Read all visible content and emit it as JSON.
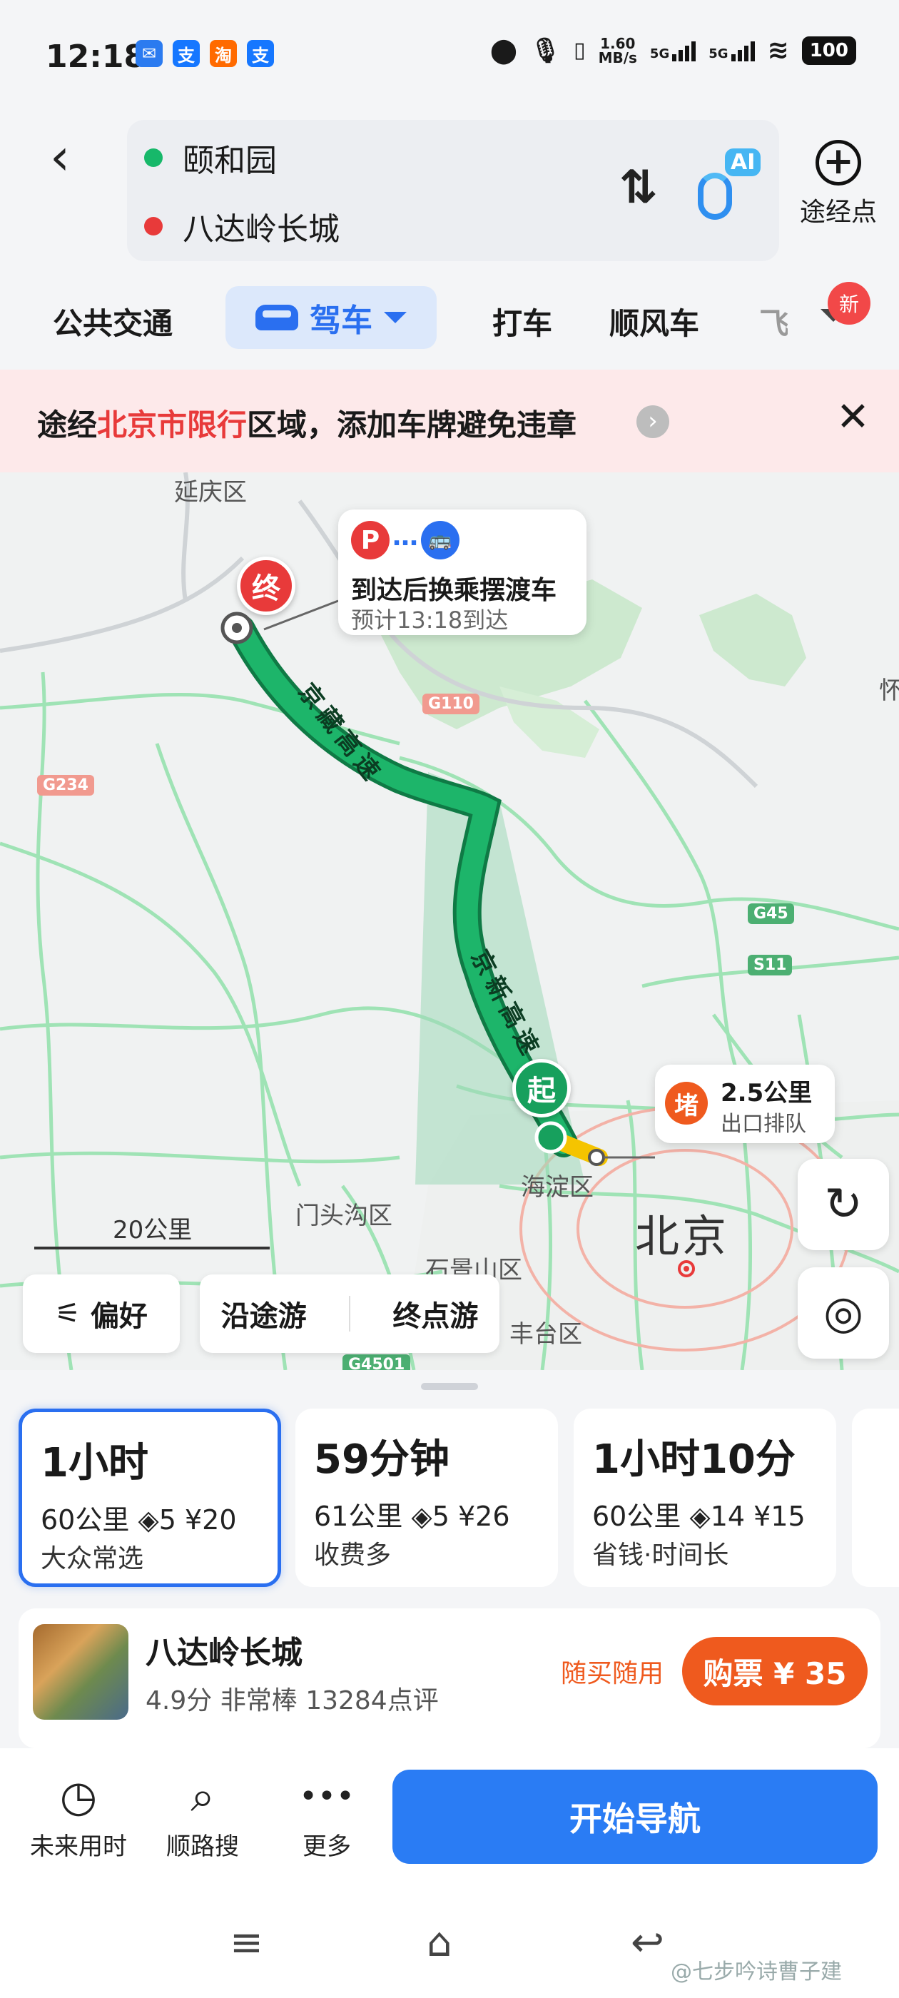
{
  "status_bar": {
    "time": "12:18",
    "apps": [
      {
        "icon": "chat-icon",
        "text": "✉",
        "color": "#2b7bf0"
      },
      {
        "icon": "alipay-icon",
        "text": "支",
        "color": "#1677ff"
      },
      {
        "icon": "taobao-icon",
        "text": "淘",
        "color": "#ff6a00"
      },
      {
        "icon": "alipay-icon",
        "text": "支",
        "color": "#1677ff"
      }
    ],
    "net_speed": "1.60",
    "net_unit": "MB/s",
    "signal1": "5G",
    "signal2": "5G",
    "battery": "100"
  },
  "header": {
    "origin": "颐和园",
    "destination": "八达岭长城",
    "swap_symbol": "⇅",
    "ai_label": "AI",
    "waypoint_label": "途经点"
  },
  "tabs": {
    "transit": "公共交通",
    "drive": "驾车",
    "taxi": "打车",
    "carpool": "顺风车",
    "flight": "飞",
    "new_badge": "新"
  },
  "banner": {
    "prefix": "途经",
    "highlight": "北京市限行",
    "suffix": "区域，添加车牌避免违章",
    "arrow": "›",
    "close": "✕"
  },
  "map": {
    "labels": {
      "yanqing": "延庆区",
      "haidian": "海淀区",
      "mentougou": "门头沟区",
      "shijingshan": "石景山区",
      "fengtai": "丰台区",
      "beijing": "北京",
      "huai": "怀"
    },
    "road_badges": {
      "g110": "G110",
      "g234": "G234",
      "g45": "G45",
      "s11": "S11",
      "g4501": "G4501"
    },
    "route_labels": {
      "jingzang": "京藏高速",
      "jingxin": "京新高速"
    },
    "callout": {
      "parking": "P",
      "dots": "…",
      "bus": "🚌",
      "title": "到达后换乘摆渡车",
      "eta": "预计13:18到达"
    },
    "end_pin": "终",
    "start_pin": "起",
    "jam": {
      "icon": "堵",
      "distance": "2.5公里",
      "desc": "出口排队"
    },
    "scale_text": "20公里",
    "refresh_icon": "↻",
    "locate_icon": "◎",
    "chips": {
      "pref": "偏好",
      "pref_icon": "⚟",
      "along": "沿途游",
      "endpoint": "终点游"
    }
  },
  "routes": [
    {
      "time": "1小时",
      "distance": "60公里",
      "lights": "5",
      "toll": "¥20",
      "tag": "大众常选",
      "selected": true
    },
    {
      "time": "59分钟",
      "distance": "61公里",
      "lights": "5",
      "toll": "¥26",
      "tag": "收费多",
      "selected": false
    },
    {
      "time": "1小时10分",
      "distance": "60公里",
      "lights": "14",
      "toll": "¥15",
      "tag": "省钱·时间长",
      "selected": false
    }
  ],
  "traffic_light_icon": "◈",
  "poi": {
    "name": "八达岭长城",
    "rating": "4.9分",
    "level": "非常棒",
    "reviews": "13284点评",
    "promo": "随买随用",
    "buy": "购票 ¥ 35"
  },
  "actions": {
    "later": "未来用时",
    "later_icon": "◷",
    "search": "顺路搜",
    "search_icon": "⌕",
    "more": "更多",
    "more_icon": "•••",
    "start_nav": "开始导航"
  },
  "system_nav": {
    "menu": "≡",
    "home": "⌂",
    "back": "↩",
    "watermark": "@七步吟诗曹子建"
  },
  "colors": {
    "accent": "#2a6ff0",
    "route_green": "#17a05d",
    "alert_red": "#e83a3a",
    "jam_orange": "#ef5a1e"
  }
}
